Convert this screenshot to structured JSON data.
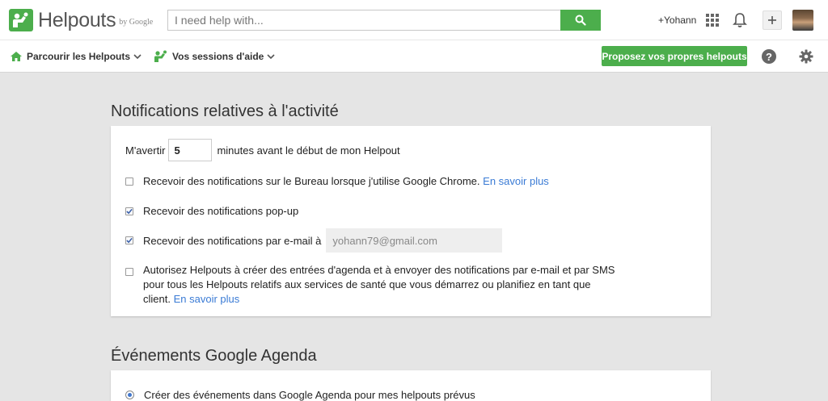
{
  "header": {
    "logo_text": "Helpouts",
    "logo_by": "by Google",
    "search_placeholder": "I need help with...",
    "user_name": "+Yohann"
  },
  "subnav": {
    "browse_label": "Parcourir les Helpouts",
    "sessions_label": "Vos sessions d'aide",
    "propose_label": "Proposez vos propres helpouts"
  },
  "notifications": {
    "title": "Notifications relatives à l'activité",
    "warn_prefix": "M'avertir",
    "minutes_value": "5",
    "warn_suffix": "minutes avant le début de mon Helpout",
    "desktop_label": "Recevoir des notifications sur le Bureau lorsque j'utilise Google Chrome.",
    "desktop_checked": false,
    "learn_more": "En savoir plus",
    "popup_label": "Recevoir des notifications pop-up",
    "popup_checked": true,
    "email_label": "Recevoir des notifications par e-mail à",
    "email_checked": true,
    "email_value": "yohann79@gmail.com",
    "health_label": "Autorisez Helpouts à créer des entrées d'agenda et à envoyer des notifications par e-mail et par SMS pour tous les Helpouts relatifs aux services de santé que vous démarrez ou planifiez en tant que client.",
    "health_checked": false
  },
  "calendar": {
    "title": "Événements Google Agenda",
    "create_label": "Créer des événements dans Google Agenda pour mes helpouts prévus"
  },
  "colors": {
    "accent_green": "#4cae4c",
    "link_blue": "#3a7bd5"
  }
}
